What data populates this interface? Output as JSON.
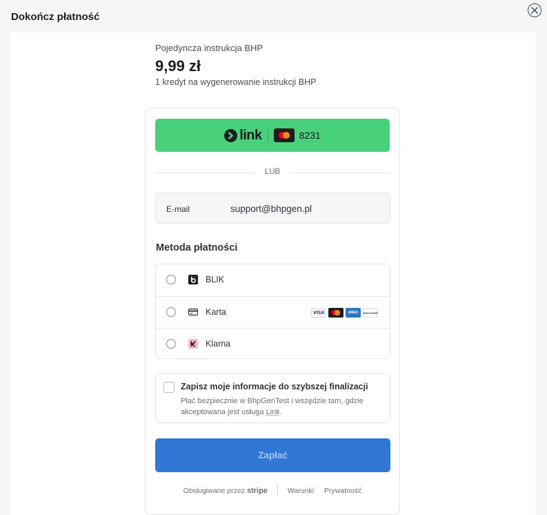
{
  "dialog": {
    "title": "Dokończ płatność"
  },
  "product": {
    "name": "Pojedyncza instrukcja BHP",
    "price": "9,99 zł",
    "description": "1 kredyt na wygenerowanie instrukcji BHP"
  },
  "link_button": {
    "brand": "link",
    "card_last4": "8231"
  },
  "divider_label": "LUB",
  "email": {
    "label": "E-mail",
    "value": "support@bhpgen.pl"
  },
  "payment_methods": {
    "title": "Metoda płatności",
    "items": [
      {
        "label": "BLIK",
        "icon": "blik-icon"
      },
      {
        "label": "Karta",
        "icon": "card-icon",
        "brands": [
          "VISA",
          "Mastercard",
          "AMEX",
          "DISCOVER"
        ]
      },
      {
        "label": "Klarna",
        "icon": "klarna-icon"
      }
    ]
  },
  "save_info": {
    "title": "Zapisz moje informacje do szybszej finalizacji",
    "description_prefix": "Płać bezpiecznie w BhpGenTest i wszędzie tam, gdzie akceptowana jest usługa ",
    "description_link": "Link",
    "description_suffix": "."
  },
  "pay_button": {
    "label": "Zapłać"
  },
  "footer": {
    "powered_by": "Obsługiwane przez",
    "stripe": "stripe",
    "terms": "Warunki",
    "privacy": "Prywatność"
  },
  "colors": {
    "link_green": "#48d17a",
    "pay_blue": "#3077d6"
  }
}
